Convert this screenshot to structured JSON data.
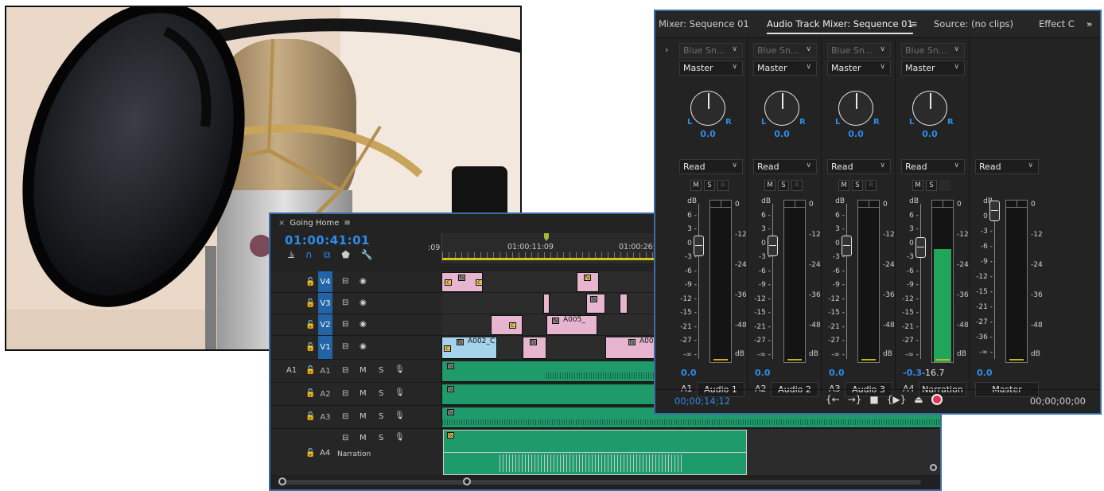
{
  "timeline": {
    "tab_title": "Going Home",
    "timecode": "01:00:41:01",
    "ruler_labels": [
      ":09",
      "01:00:11:09",
      "01:00:26:"
    ],
    "tracks": [
      {
        "lock": "🔓",
        "name": "V4"
      },
      {
        "lock": "🔓",
        "name": "V3"
      },
      {
        "lock": "🔓",
        "name": "V2"
      },
      {
        "lock": "🔓",
        "name": "V1"
      },
      {
        "src": "A1",
        "lock": "🔓",
        "name": "A1",
        "m": "M",
        "s": "S"
      },
      {
        "lock": "🔓",
        "name": "A2",
        "m": "M",
        "s": "S"
      },
      {
        "lock": "🔓",
        "name": "A3",
        "m": "M",
        "s": "S"
      },
      {
        "lock": "🔓",
        "name": "A4",
        "label": "Narration",
        "m": "M",
        "s": "S"
      }
    ],
    "clip_labels": {
      "a002": "A002_C",
      "a005": "A005_",
      "a00": "A00",
      "c": "C",
      "fx": "fx"
    }
  },
  "mixer": {
    "tabs": [
      "Mixer: Sequence 01",
      "Audio Track Mixer: Sequence 01",
      "Source: (no clips)",
      "Effect C"
    ],
    "menu_glyph": "≡",
    "overflow_glyph": "»",
    "channels": [
      {
        "input": "Blue Sn...",
        "output": "Master",
        "pan": "0.0",
        "mode": "Read",
        "vol": "0.0",
        "id": "A1",
        "name": "Audio 1",
        "level": 0.0
      },
      {
        "input": "Blue Sn...",
        "output": "Master",
        "pan": "0.0",
        "mode": "Read",
        "vol": "0.0",
        "id": "A2",
        "name": "Audio 2",
        "level": 0.0
      },
      {
        "input": "Blue Sn...",
        "output": "Master",
        "pan": "0.0",
        "mode": "Read",
        "vol": "0.0",
        "id": "A3",
        "name": "Audio 3",
        "level": 0.0
      },
      {
        "input": "Blue Sn...",
        "output": "Master",
        "pan": "0.0",
        "mode": "Read",
        "vol": "-0.3",
        "peak": "-16.7",
        "id": "A4",
        "name": "Narration",
        "level": 0.7
      }
    ],
    "master": {
      "mode": "Read",
      "vol": "0.0",
      "name": "Master"
    },
    "pan_l": "L",
    "pan_r": "R",
    "msr": [
      "M",
      "S",
      "R"
    ],
    "left_scale": [
      "dB",
      "6",
      "3",
      "0",
      "-3",
      "-6",
      "-9",
      "-12",
      "-15",
      "-21",
      "-27",
      "-∞"
    ],
    "right_scale": [
      "0",
      "-12",
      "-24",
      "-36",
      "-48",
      "dB"
    ],
    "master_left_scale": [
      "dB",
      "0",
      "-3",
      "-6",
      "-9",
      "-12",
      "-15",
      "-21",
      "-27",
      "-36",
      "-∞"
    ],
    "timecode_left": "00;00;14;12",
    "timecode_right": "00;00;00;00",
    "transport": [
      "{←",
      "→}",
      "■",
      "{▶}",
      "⏏"
    ]
  },
  "colors": {
    "accent": "#2d8ceb",
    "meter": "#21a55a",
    "record": "#e8315a"
  }
}
